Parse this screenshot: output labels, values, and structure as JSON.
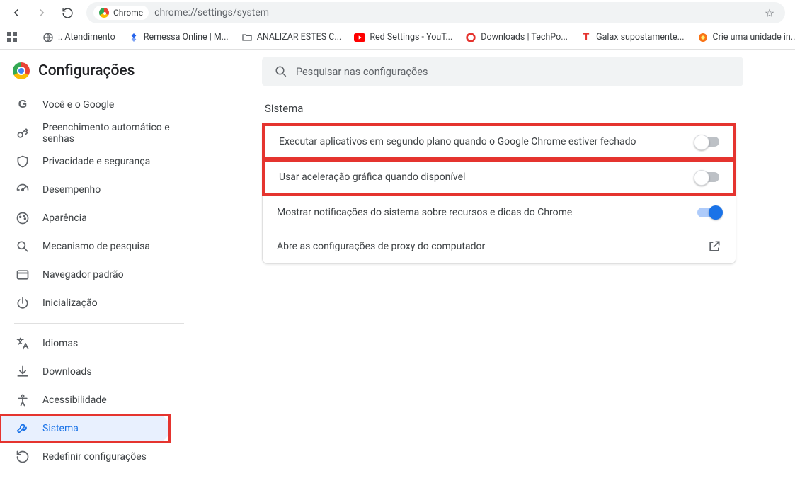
{
  "nav": {
    "url": "chrome://settings/system",
    "chip_label": "Chrome"
  },
  "bookmarks": [
    {
      "name": "atendimento",
      "label": ":. Atendimento",
      "icon": "globe",
      "color": "#5f6368"
    },
    {
      "name": "remessa",
      "label": "Remessa Online | M...",
      "icon": "diamond",
      "color": "#2563eb"
    },
    {
      "name": "analizar",
      "label": "ANALIZAR ESTES C...",
      "icon": "folder",
      "color": "#5f6368"
    },
    {
      "name": "youtube",
      "label": "Red Settings - YouT...",
      "icon": "youtube",
      "color": "#ff0000"
    },
    {
      "name": "downloads",
      "label": "Downloads | TechPo...",
      "icon": "circle",
      "color": "#e5342f"
    },
    {
      "name": "galax",
      "label": "Galax supostamente...",
      "icon": "T",
      "color": "#e5342f"
    },
    {
      "name": "unidade",
      "label": "Crie uma unidade in...",
      "icon": "swirl",
      "color": "#f97316"
    }
  ],
  "header": {
    "title": "Configurações"
  },
  "sidebar": {
    "items": [
      {
        "name": "you-google",
        "label": "Você e o Google",
        "icon": "G"
      },
      {
        "name": "autofill",
        "label": "Preenchimento automático e senhas",
        "icon": "key"
      },
      {
        "name": "privacy",
        "label": "Privacidade e segurança",
        "icon": "shield"
      },
      {
        "name": "performance",
        "label": "Desempenho",
        "icon": "speed"
      },
      {
        "name": "appearance",
        "label": "Aparência",
        "icon": "palette"
      },
      {
        "name": "search-engine",
        "label": "Mecanismo de pesquisa",
        "icon": "search"
      },
      {
        "name": "default-browser",
        "label": "Navegador padrão",
        "icon": "browser"
      },
      {
        "name": "on-startup",
        "label": "Inicialização",
        "icon": "power"
      }
    ],
    "items2": [
      {
        "name": "languages",
        "label": "Idiomas",
        "icon": "translate"
      },
      {
        "name": "downloads",
        "label": "Downloads",
        "icon": "download"
      },
      {
        "name": "accessibility",
        "label": "Acessibilidade",
        "icon": "accessibility"
      },
      {
        "name": "system",
        "label": "Sistema",
        "icon": "wrench",
        "active": true,
        "highlight": true
      },
      {
        "name": "reset",
        "label": "Redefinir configurações",
        "icon": "reset"
      }
    ]
  },
  "search": {
    "placeholder": "Pesquisar nas configurações"
  },
  "section": {
    "title": "Sistema",
    "rows": [
      {
        "name": "bg-apps",
        "label": "Executar aplicativos em segundo plano quando o Google Chrome estiver fechado",
        "toggle": "off",
        "highlight": true
      },
      {
        "name": "gpu-accel",
        "label": "Usar aceleração gráfica quando disponível",
        "toggle": "off",
        "highlight": true
      },
      {
        "name": "sys-notif",
        "label": "Mostrar notificações do sistema sobre recursos e dicas do Chrome",
        "toggle": "on"
      },
      {
        "name": "proxy",
        "label": "Abre as configurações de proxy do computador",
        "action": "openext"
      }
    ]
  }
}
